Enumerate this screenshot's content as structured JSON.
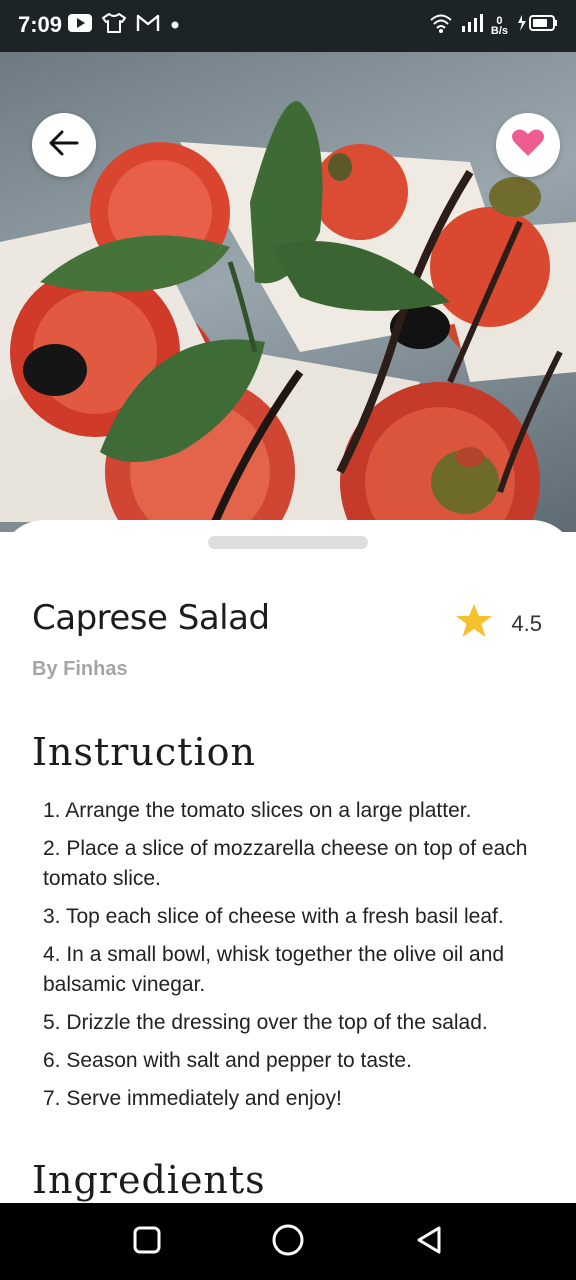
{
  "status_bar": {
    "time": "7:09",
    "icons_left": [
      "youtube-icon",
      "tshirt-icon",
      "gmail-icon",
      "dot-icon"
    ],
    "icons_right": [
      "wifi-icon",
      "signal-icon",
      "data-speed-icon",
      "battery-charging-icon"
    ],
    "data_speed_value": "0",
    "data_speed_unit": "B/s"
  },
  "header": {
    "back_icon": "arrow-left-icon",
    "favorite_icon": "heart-icon",
    "favorite_color": "#ee5d8f"
  },
  "recipe": {
    "title": "Caprese Salad",
    "rating": "4.5",
    "rating_icon": "star-icon",
    "star_color": "#f6c12c",
    "author": "By Finhas"
  },
  "instruction": {
    "heading": "Instruction",
    "steps": [
      "1. Arrange the tomato slices on a large platter.",
      "2. Place a slice of mozzarella cheese on top of each tomato slice.",
      "3. Top each slice of cheese with a fresh basil leaf.",
      "4. In a small bowl, whisk together the olive oil and balsamic vinegar.",
      "5. Drizzle the dressing over the top of the salad.",
      "6. Season with salt and pepper to taste.",
      "7. Serve immediately and enjoy!"
    ]
  },
  "ingredients": {
    "heading": "Ingredients"
  },
  "nav_bar": {
    "items": [
      "recent-apps-icon",
      "home-icon",
      "back-icon"
    ]
  }
}
